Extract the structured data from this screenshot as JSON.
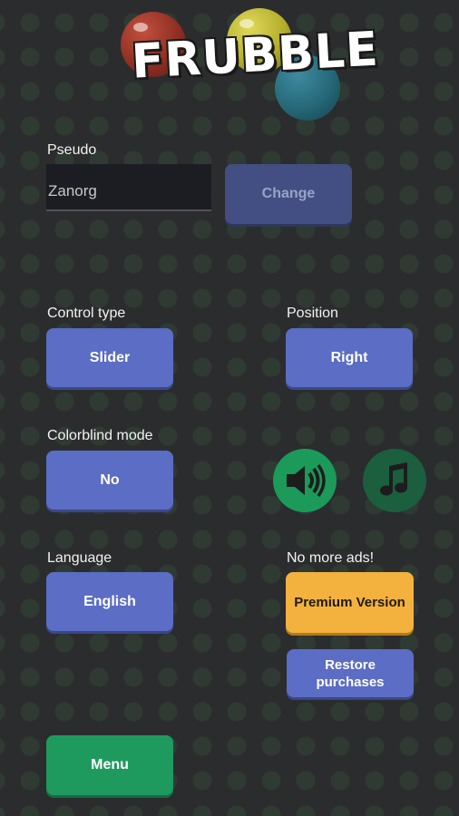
{
  "logo": {
    "text": "FRUBBLE"
  },
  "pseudo": {
    "label": "Pseudo",
    "value": "Zanorg",
    "change_label": "Change"
  },
  "control_type": {
    "label": "Control type",
    "value": "Slider"
  },
  "position": {
    "label": "Position",
    "value": "Right"
  },
  "colorblind": {
    "label": "Colorblind mode",
    "value": "No"
  },
  "sound": {
    "icon": "speaker-icon",
    "color": "#1b9a5a"
  },
  "music": {
    "icon": "music-note-icon",
    "color": "#1b5f3e"
  },
  "language": {
    "label": "Language",
    "value": "English"
  },
  "ads": {
    "label": "No more ads!",
    "premium_label": "Premium Version",
    "restore_line1": "Restore",
    "restore_line2": "purchases"
  },
  "menu": {
    "label": "Menu"
  }
}
